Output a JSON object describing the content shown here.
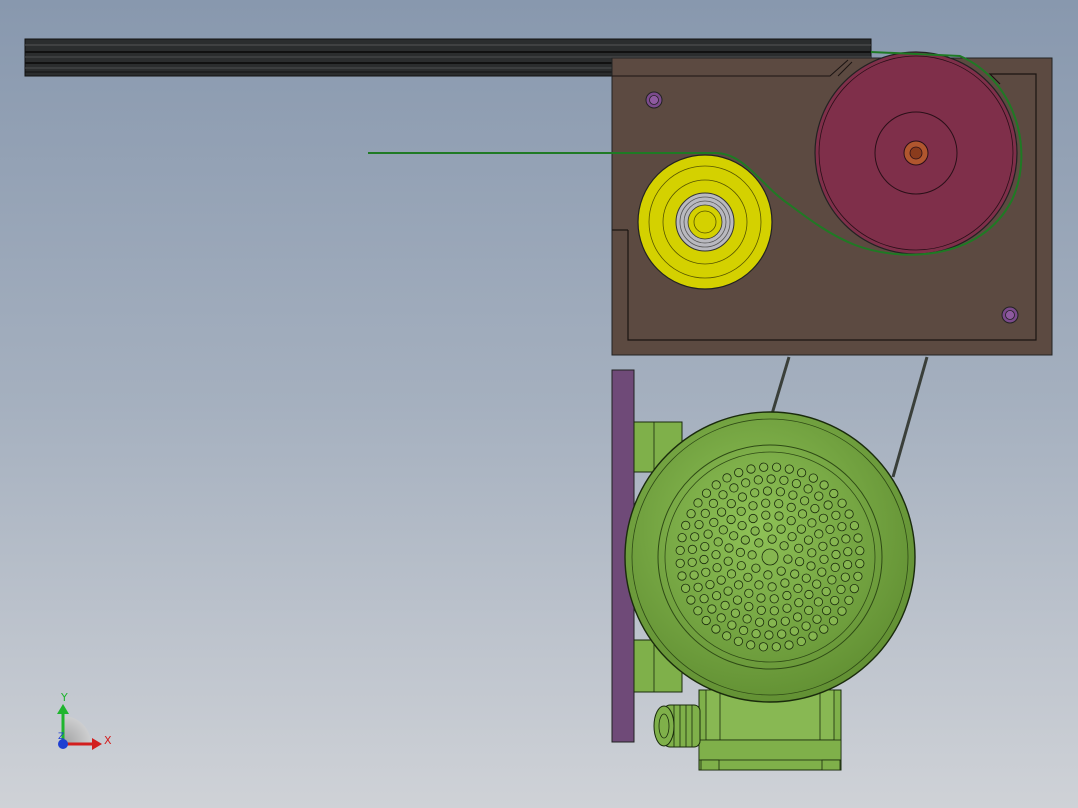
{
  "viewport": {
    "background_top": "#8898ae",
    "background_bottom": "#cfd2d7"
  },
  "colors": {
    "rail": "#2a2c2d",
    "plate": "#5c4a41",
    "large_pulley": "#7f2f4a",
    "small_pulley": "#d4d100",
    "bearing": "#b9b9bf",
    "belt": "#1f7a24",
    "motor": "#7fb04a",
    "mount_plate": "#6f4a78",
    "bolt": "#7b4a8c",
    "axis_x": "#d21e1e",
    "axis_y": "#1fb52e",
    "axis_z": "#1e3fd2"
  },
  "triad": {
    "x_label": "X",
    "y_label": "Y",
    "z_label": "Z"
  }
}
